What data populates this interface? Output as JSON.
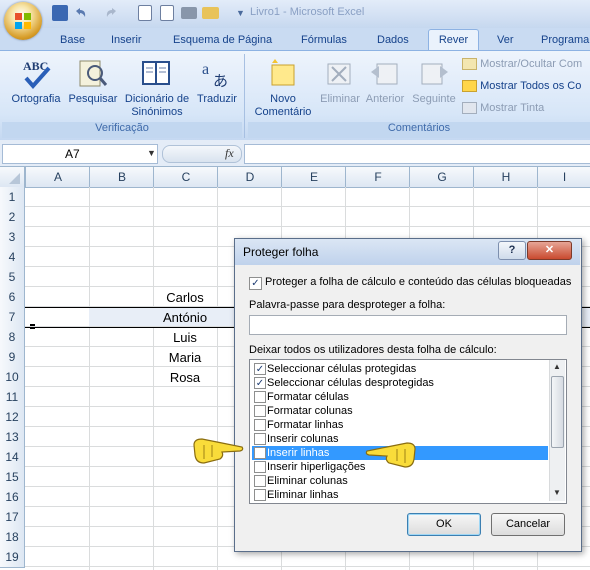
{
  "window": {
    "title": "Livro1 - Microsoft Excel"
  },
  "quick_access": {
    "icons": [
      "save-icon",
      "undo-icon",
      "redo-icon",
      "print-preview-icon",
      "new-document-icon",
      "print-icon",
      "open-folder-icon"
    ]
  },
  "tabs": [
    "Base",
    "Inserir",
    "Esquema de Página",
    "Fórmulas",
    "Dados",
    "Rever",
    "Ver",
    "Programa"
  ],
  "active_tab": "Rever",
  "ribbon": {
    "verificacao": {
      "label": "Verificação",
      "buttons": [
        {
          "label": "Ortografia",
          "icon": "spelling-icon"
        },
        {
          "label": "Pesquisar",
          "icon": "research-icon"
        },
        {
          "label": "Dicionário de Sinónimos",
          "line1": "Dicionário de",
          "line2": "Sinónimos",
          "icon": "thesaurus-icon"
        },
        {
          "label": "Traduzir",
          "icon": "translate-icon"
        }
      ]
    },
    "comentarios": {
      "label": "Comentários",
      "new": {
        "line1": "Novo",
        "line2": "Comentário"
      },
      "eliminar": "Eliminar",
      "anterior": "Anterior",
      "seguinte": "Seguinte",
      "mostrar_ocultar": "Mostrar/Ocultar Com",
      "mostrar_todos": "Mostrar Todos os Co",
      "mostrar_tinta": "Mostrar Tinta"
    }
  },
  "formula_bar": {
    "name_box": "A7",
    "fx": "fx",
    "value": ""
  },
  "columns": [
    "A",
    "B",
    "C",
    "D",
    "E",
    "F",
    "G",
    "H",
    "I"
  ],
  "rows": [
    "1",
    "2",
    "3",
    "4",
    "5",
    "6",
    "7",
    "8",
    "9",
    "10",
    "11",
    "12",
    "13",
    "14",
    "15",
    "16",
    "17",
    "18",
    "19"
  ],
  "cells": {
    "C6": "Carlos",
    "C7": "António",
    "C8": "Luis",
    "C9": "Maria",
    "C10": "Rosa"
  },
  "dialog": {
    "title": "Proteger folha",
    "help": "?",
    "close": "✕",
    "protect_checkbox": {
      "label": "Proteger a folha de cálculo e conteúdo das células bloqueadas",
      "checked": true
    },
    "password_label": "Palavra-passe para desproteger a folha:",
    "password_value": "",
    "permissions_label": "Deixar todos os utilizadores desta folha de cálculo:",
    "permissions": [
      {
        "label": "Seleccionar células protegidas",
        "checked": true
      },
      {
        "label": "Seleccionar células desprotegidas",
        "checked": true
      },
      {
        "label": "Formatar células",
        "checked": false
      },
      {
        "label": "Formatar colunas",
        "checked": false
      },
      {
        "label": "Formatar linhas",
        "checked": false
      },
      {
        "label": "Inserir colunas",
        "checked": false
      },
      {
        "label": "Inserir linhas",
        "checked": false,
        "selected": true
      },
      {
        "label": "Inserir hiperligações",
        "checked": false
      },
      {
        "label": "Eliminar colunas",
        "checked": false
      },
      {
        "label": "Eliminar linhas",
        "checked": false
      }
    ],
    "ok": "OK",
    "cancel": "Cancelar"
  },
  "colors": {
    "selection": "#3399ff",
    "ribbon": "#dbe8f8",
    "accent": "#15428b"
  }
}
